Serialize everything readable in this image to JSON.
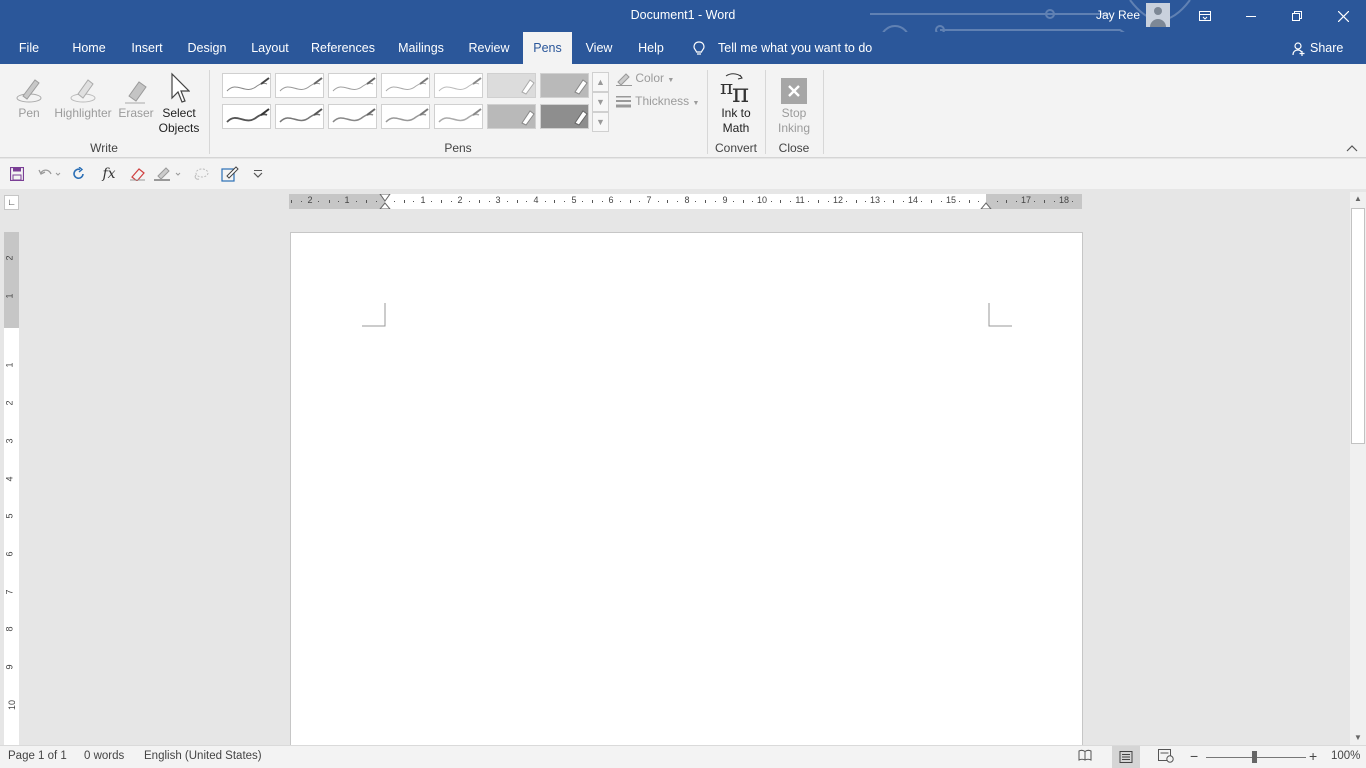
{
  "titlebar": {
    "title": "Document1  -  Word",
    "user": "Jay Ree"
  },
  "tabs": [
    {
      "label": "File"
    },
    {
      "label": "Home"
    },
    {
      "label": "Insert"
    },
    {
      "label": "Design"
    },
    {
      "label": "Layout"
    },
    {
      "label": "References"
    },
    {
      "label": "Mailings"
    },
    {
      "label": "Review"
    },
    {
      "label": "Pens",
      "active": true
    },
    {
      "label": "View"
    },
    {
      "label": "Help"
    }
  ],
  "tellme": "Tell me what you want to do",
  "share": "Share",
  "ribbon": {
    "write": {
      "pen": "Pen",
      "highlighter": "Highlighter",
      "eraser": "Eraser",
      "select_objects_1": "Select",
      "select_objects_2": "Objects",
      "label": "Write"
    },
    "pens": {
      "label": "Pens",
      "color": "Color",
      "thickness": "Thickness"
    },
    "convert": {
      "ink_to_math_1": "Ink to",
      "ink_to_math_2": "Math",
      "label": "Convert"
    },
    "close": {
      "stop_inking_1": "Stop",
      "stop_inking_2": "Inking",
      "label": "Close"
    }
  },
  "ruler": {
    "horizontal": [
      "2",
      "1",
      "1",
      "2",
      "3",
      "4",
      "5",
      "6",
      "7",
      "8",
      "9",
      "10",
      "11",
      "12",
      "13",
      "14",
      "15",
      "17",
      "18"
    ],
    "vertical": [
      "2",
      "1",
      "1",
      "2",
      "3",
      "4",
      "5",
      "6",
      "7",
      "8",
      "9",
      "10"
    ]
  },
  "statusbar": {
    "page": "Page 1 of 1",
    "words": "0 words",
    "language": "English (United States)",
    "zoom": "100%",
    "zoom_level": 1.0
  },
  "colors": {
    "accent": "#2b579a",
    "ribbon_bg": "#f3f3f3",
    "canvas_bg": "#e6e6e6"
  }
}
